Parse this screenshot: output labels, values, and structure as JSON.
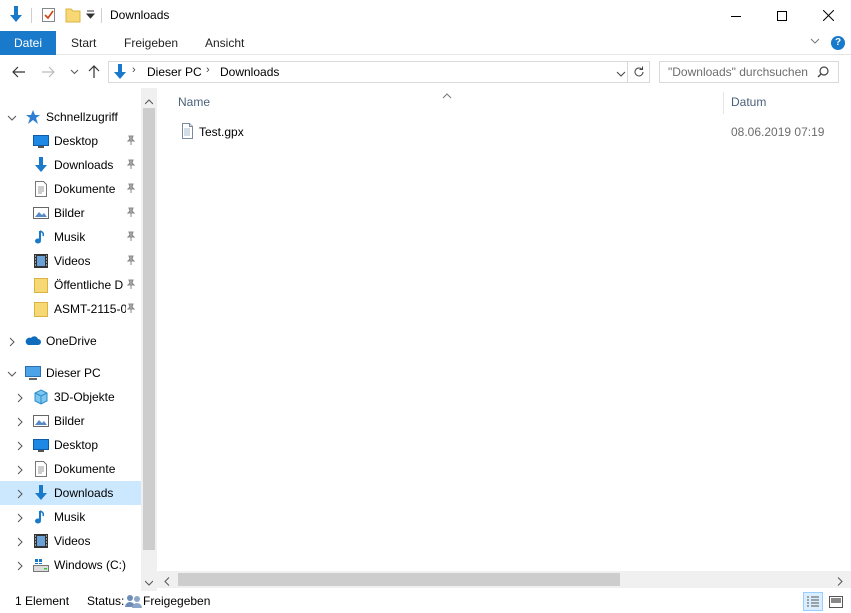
{
  "window": {
    "title": "Downloads",
    "controls": {
      "minimize": "minimize-icon",
      "maximize": "maximize-icon",
      "close": "close-icon"
    }
  },
  "ribbon": {
    "tabs": [
      {
        "label": "Datei"
      },
      {
        "label": "Start"
      },
      {
        "label": "Freigeben"
      },
      {
        "label": "Ansicht"
      }
    ],
    "help": "?"
  },
  "address": {
    "crumbs": [
      "Dieser PC",
      "Downloads"
    ],
    "search_placeholder": "\"Downloads\" durchsuchen"
  },
  "sidebar": {
    "quick_access": {
      "label": "Schnellzugriff",
      "items": [
        {
          "label": "Desktop",
          "icon": "desktop-icon"
        },
        {
          "label": "Downloads",
          "icon": "download-icon"
        },
        {
          "label": "Dokumente",
          "icon": "document-icon"
        },
        {
          "label": "Bilder",
          "icon": "pictures-icon"
        },
        {
          "label": "Musik",
          "icon": "music-icon"
        },
        {
          "label": "Videos",
          "icon": "videos-icon"
        },
        {
          "label": "Öffentliche D",
          "icon": "folder-icon"
        },
        {
          "label": "ASMT-2115-0",
          "icon": "folder-icon"
        }
      ]
    },
    "onedrive": {
      "label": "OneDrive"
    },
    "this_pc": {
      "label": "Dieser PC",
      "items": [
        {
          "label": "3D-Objekte",
          "icon": "3d-objects-icon"
        },
        {
          "label": "Bilder",
          "icon": "pictures-icon"
        },
        {
          "label": "Desktop",
          "icon": "desktop-icon"
        },
        {
          "label": "Dokumente",
          "icon": "document-icon"
        },
        {
          "label": "Downloads",
          "icon": "download-icon",
          "selected": true
        },
        {
          "label": "Musik",
          "icon": "music-icon"
        },
        {
          "label": "Videos",
          "icon": "videos-icon"
        },
        {
          "label": "Windows (C:)",
          "icon": "drive-icon"
        }
      ]
    }
  },
  "main": {
    "columns": {
      "name": "Name",
      "date": "Datum"
    },
    "files": [
      {
        "name": "Test.gpx",
        "date": "08.06.2019 07:19",
        "icon": "file-icon"
      }
    ]
  },
  "status": {
    "count": "1 Element",
    "status_label": "Status:",
    "share_label": "Freigegeben"
  },
  "colors": {
    "accent": "#1979ca",
    "selection": "#cce8ff",
    "header_text": "#4c607a"
  }
}
